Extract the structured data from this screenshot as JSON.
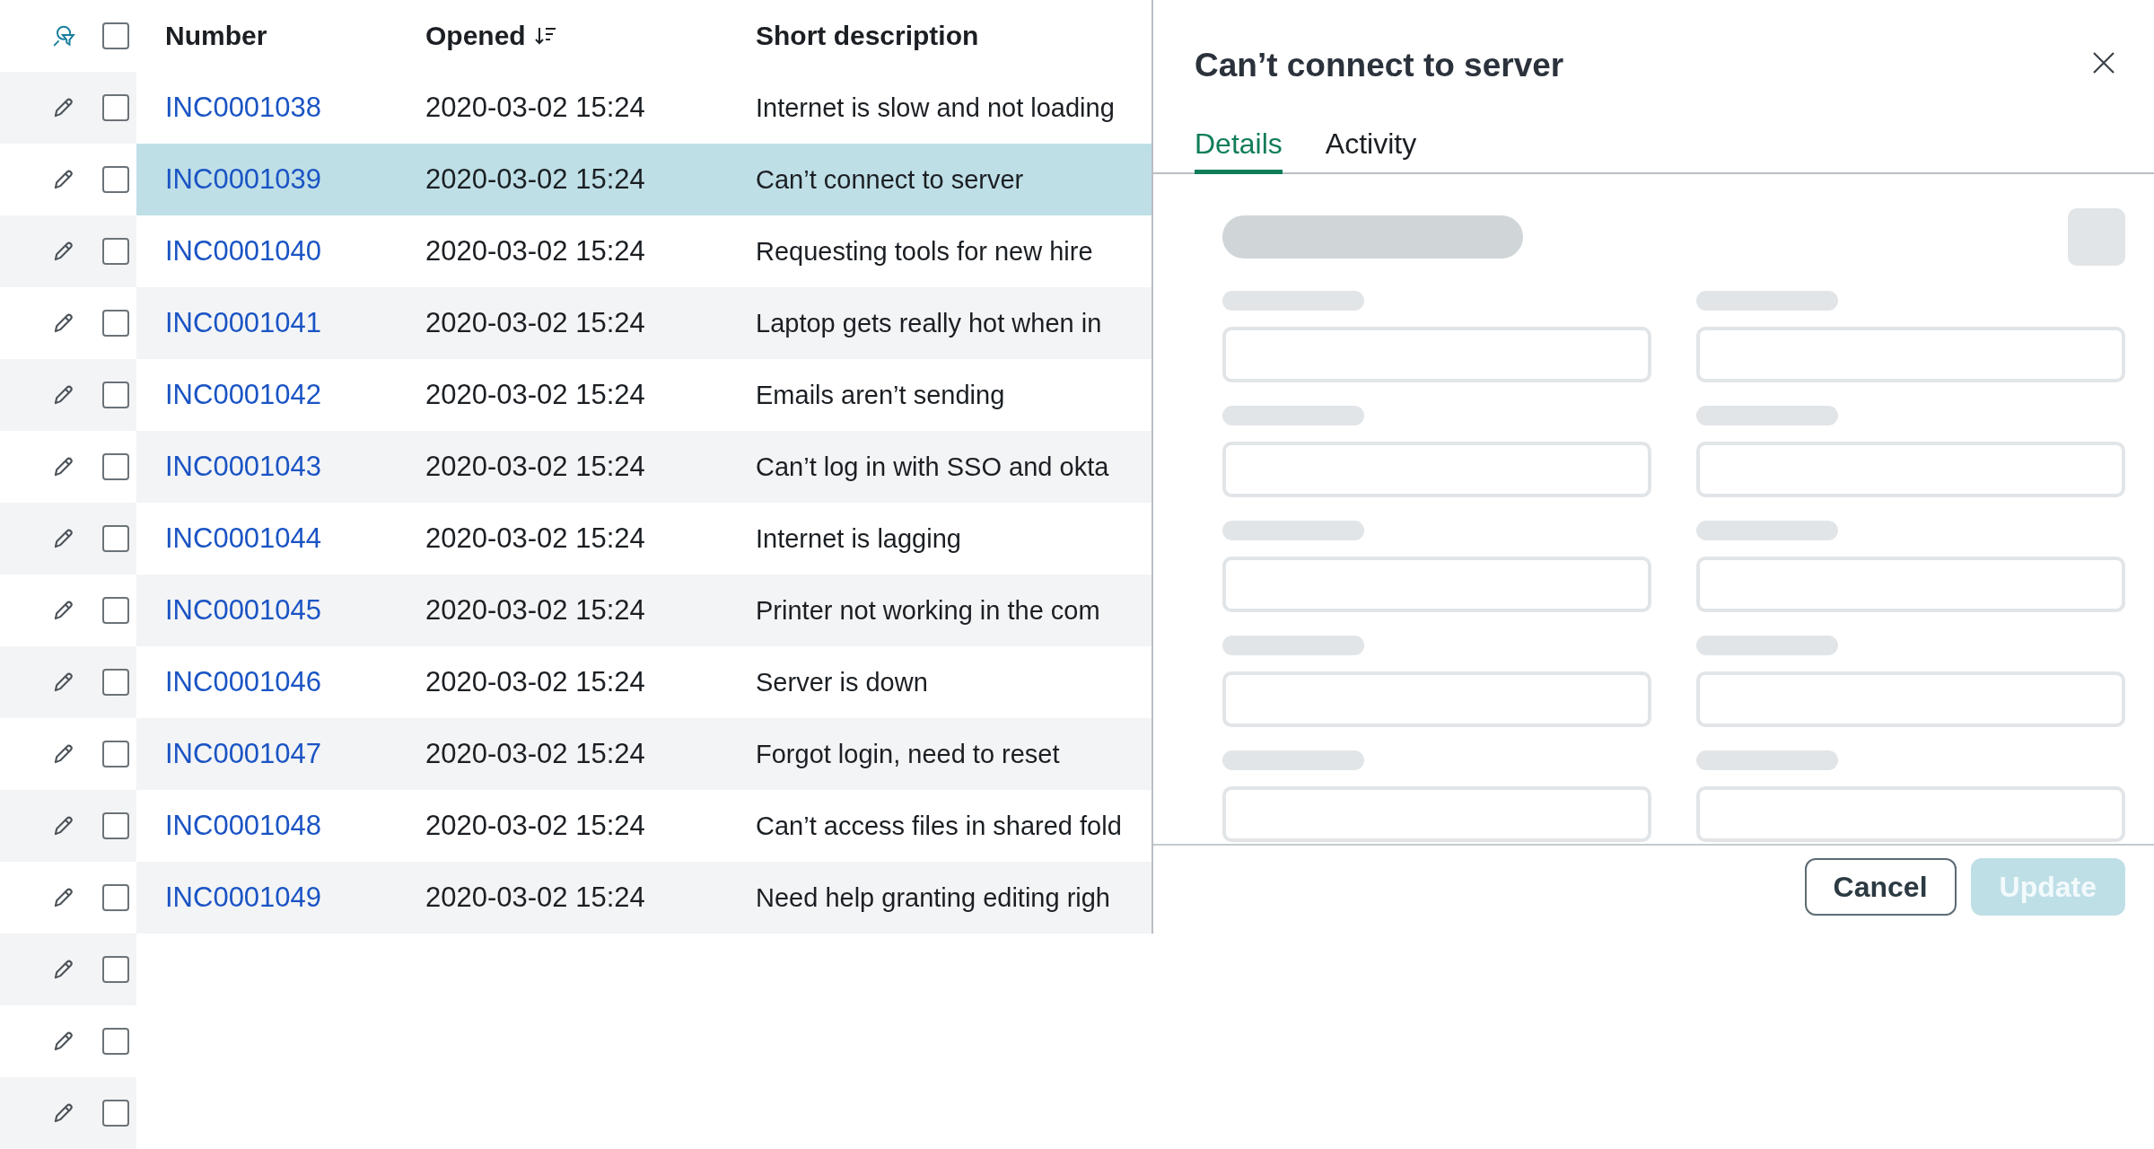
{
  "table": {
    "select_all": {
      "checked": false
    },
    "columns": [
      "Number",
      "Opened",
      "Short description"
    ],
    "rows": [
      {
        "number": "INC0001038",
        "opened": "2020-03-02 15:24",
        "description": "Internet is slow and not loading",
        "selected": false,
        "checked": false
      },
      {
        "number": "INC0001039",
        "opened": "2020-03-02 15:24",
        "description": "Can’t connect to server",
        "selected": true,
        "checked": false
      },
      {
        "number": "INC0001040",
        "opened": "2020-03-02 15:24",
        "description": "Requesting tools for new hire",
        "selected": false,
        "checked": false
      },
      {
        "number": "INC0001041",
        "opened": "2020-03-02 15:24",
        "description": "Laptop gets really hot when in",
        "selected": false,
        "checked": false
      },
      {
        "number": "INC0001042",
        "opened": "2020-03-02 15:24",
        "description": "Emails aren’t sending",
        "selected": false,
        "checked": false
      },
      {
        "number": "INC0001043",
        "opened": "2020-03-02 15:24",
        "description": "Can’t log in with SSO and okta",
        "selected": false,
        "checked": false
      },
      {
        "number": "INC0001044",
        "opened": "2020-03-02 15:24",
        "description": "Internet is lagging",
        "selected": false,
        "checked": false
      },
      {
        "number": "INC0001045",
        "opened": "2020-03-02 15:24",
        "description": "Printer not working in the com",
        "selected": false,
        "checked": false
      },
      {
        "number": "INC0001046",
        "opened": "2020-03-02 15:24",
        "description": "Server is down",
        "selected": false,
        "checked": false
      },
      {
        "number": "INC0001047",
        "opened": "2020-03-02 15:24",
        "description": "Forgot login, need to reset",
        "selected": false,
        "checked": false
      },
      {
        "number": "INC0001048",
        "opened": "2020-03-02 15:24",
        "description": "Can’t access files in shared fold",
        "selected": false,
        "checked": false
      },
      {
        "number": "INC0001049",
        "opened": "2020-03-02 15:24",
        "description": "Need help granting editing righ",
        "selected": false,
        "checked": false
      },
      {
        "kind": "empty",
        "selected": false,
        "checked": false
      },
      {
        "kind": "empty",
        "selected": false,
        "checked": false
      },
      {
        "kind": "empty",
        "selected": false,
        "checked": false
      }
    ]
  },
  "panel": {
    "title": "Can’t connect to server",
    "tabs": [
      {
        "label": "Details",
        "selected": true
      },
      {
        "label": "Activity",
        "selected": false
      }
    ],
    "buttons": [
      {
        "label": "Cancel",
        "kind": "secondary",
        "disabled": false
      },
      {
        "label": "Update",
        "kind": "primary",
        "disabled": true
      }
    ]
  }
}
